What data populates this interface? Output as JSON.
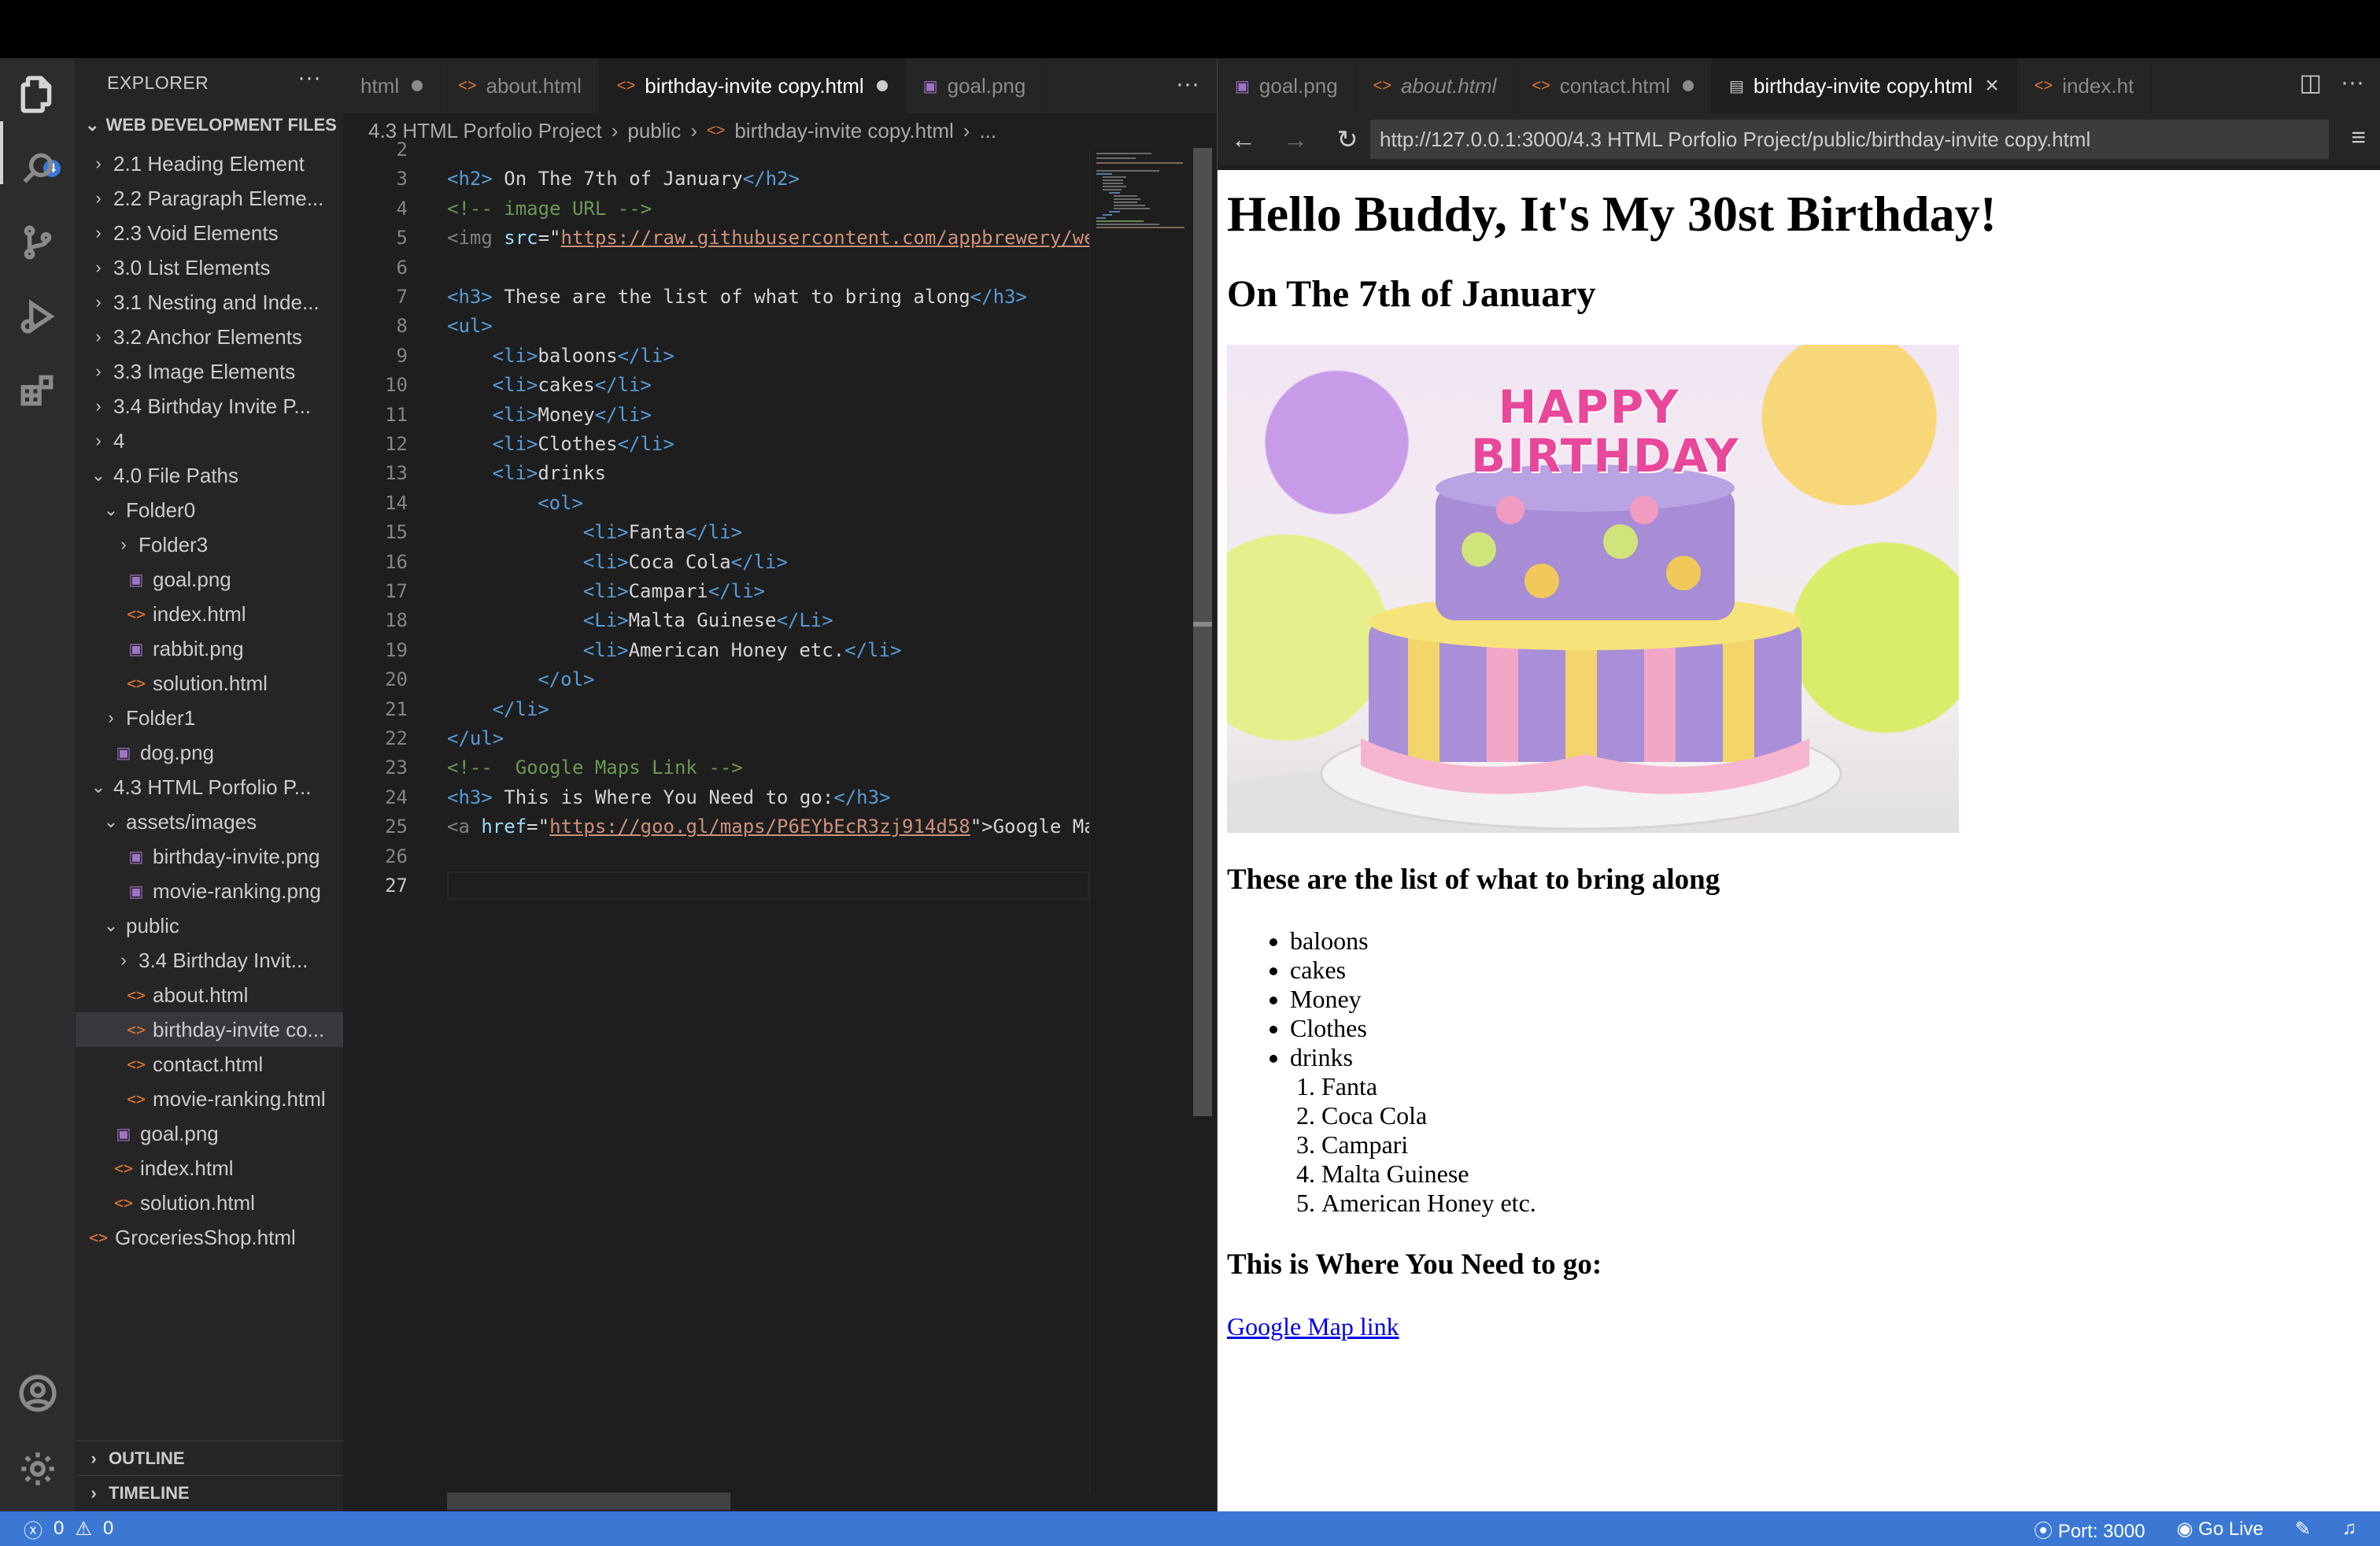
{
  "explorer": {
    "title": "EXPLORER",
    "more": "···",
    "section": "WEB DEVELOPMENT FILES",
    "badge": "4",
    "items": [
      {
        "label": "2.1 Heading Element",
        "type": "folder"
      },
      {
        "label": "2.2 Paragraph Eleme...",
        "type": "folder"
      },
      {
        "label": "2.3 Void Elements",
        "type": "folder"
      },
      {
        "label": "3.0 List Elements",
        "type": "folder"
      },
      {
        "label": "3.1 Nesting and Inde...",
        "type": "folder"
      },
      {
        "label": "3.2 Anchor Elements",
        "type": "folder"
      },
      {
        "label": "3.3 Image Elements",
        "type": "folder"
      },
      {
        "label": "3.4 Birthday Invite P...",
        "type": "folder"
      },
      {
        "label": "4",
        "type": "folder"
      },
      {
        "label": "4.0 File Paths",
        "type": "folder-open"
      },
      {
        "label": "Folder0",
        "type": "folder-open"
      },
      {
        "label": "Folder3",
        "type": "folder"
      },
      {
        "label": "goal.png",
        "type": "image"
      },
      {
        "label": "index.html",
        "type": "html"
      },
      {
        "label": "rabbit.png",
        "type": "image"
      },
      {
        "label": "solution.html",
        "type": "html"
      },
      {
        "label": "Folder1",
        "type": "folder"
      },
      {
        "label": "dog.png",
        "type": "image"
      },
      {
        "label": "4.3 HTML Porfolio P...",
        "type": "folder-open"
      },
      {
        "label": "assets/images",
        "type": "folder-open"
      },
      {
        "label": "birthday-invite.png",
        "type": "image"
      },
      {
        "label": "movie-ranking.png",
        "type": "image"
      },
      {
        "label": "public",
        "type": "folder-open"
      },
      {
        "label": "3.4 Birthday Invit...",
        "type": "folder"
      },
      {
        "label": "about.html",
        "type": "html"
      },
      {
        "label": "birthday-invite co...",
        "type": "html"
      },
      {
        "label": "contact.html",
        "type": "html"
      },
      {
        "label": "movie-ranking.html",
        "type": "html"
      },
      {
        "label": "goal.png",
        "type": "image"
      },
      {
        "label": "index.html",
        "type": "html"
      },
      {
        "label": "solution.html",
        "type": "html"
      },
      {
        "label": "GroceriesShop.html",
        "type": "html"
      }
    ],
    "outline": "OUTLINE",
    "timeline": "TIMELINE"
  },
  "editor": {
    "tabs": [
      {
        "label": "html"
      },
      {
        "label": "about.html"
      },
      {
        "label": "birthday-invite copy.html"
      },
      {
        "label": "goal.png"
      }
    ],
    "more": "···",
    "breadcrumb": [
      "4.3 HTML Porfolio Project",
      "public",
      "birthday-invite copy.html",
      "..."
    ],
    "line_numbers": [
      "2",
      "3",
      "4",
      "5",
      "6",
      "7",
      "8",
      "9",
      "10",
      "11",
      "12",
      "13",
      "14",
      "15",
      "16",
      "17",
      "18",
      "19",
      "20",
      "21",
      "22",
      "23",
      "24",
      "25",
      "26",
      "27"
    ],
    "lines": {
      "l3": {
        "open": "<h2>",
        "text": " On The 7th of January",
        "close": "</h2>"
      },
      "l4": "<!-- image URL -->",
      "l5": {
        "tag": "<img ",
        "attr": "src",
        "eq": "=\"",
        "url": "https://raw.githubusercontent.com/appbrewery/we"
      },
      "l7": {
        "open": "<h3>",
        "text": " These are the list of what to bring along",
        "close": "</h3>"
      },
      "l8": "<ul>",
      "l9": {
        "open": "<li>",
        "text": "baloons",
        "close": "</li>"
      },
      "l10": {
        "open": "<li>",
        "text": "cakes",
        "close": "</li>"
      },
      "l11": {
        "open": "<li>",
        "text": "Money",
        "close": "</li>"
      },
      "l12": {
        "open": "<li>",
        "text": "Clothes",
        "close": "</li>"
      },
      "l13": {
        "open": "<li>",
        "text": "drinks"
      },
      "l14": "<ol>",
      "l15": {
        "open": "<li>",
        "text": "Fanta",
        "close": "</li>"
      },
      "l16": {
        "open": "<li>",
        "text": "Coca Cola",
        "close": "</li>"
      },
      "l17": {
        "open": "<li>",
        "text": "Campari",
        "close": "</li>"
      },
      "l18": {
        "open": "<Li>",
        "text": "Malta Guinese",
        "close": "</Li>"
      },
      "l19": {
        "open": "<li>",
        "text": "American Honey etc.",
        "close": "</li>"
      },
      "l20": "</ol>",
      "l21": "</li>",
      "l22": "</ul>",
      "l23": "<!--  Google Maps Link -->",
      "l24": {
        "open": "<h3>",
        "text": " This is Where You Need to go:",
        "close": "</h3>"
      },
      "l25": {
        "tag": "<a ",
        "attr": "href",
        "eq": "=\"",
        "url": "https://goo.gl/maps/P6EYbEcR3zj914d58",
        "end": "\">Google Ma"
      }
    }
  },
  "preview": {
    "tabs": [
      {
        "label": "goal.png"
      },
      {
        "label": "about.html"
      },
      {
        "label": "contact.html"
      },
      {
        "label": "birthday-invite copy.html"
      },
      {
        "label": "index.ht"
      }
    ],
    "close": "×",
    "url": "http://127.0.0.1:3000/4.3 HTML Porfolio Project/public/birthday-invite copy.html",
    "page": {
      "h1": "Hello Buddy, It's My 30st Birthday!",
      "h2": "On The 7th of January",
      "cake_text": "HAPPY BIRTHDAY",
      "h3_list": "These are the list of what to bring along",
      "items": [
        "baloons",
        "cakes",
        "Money",
        "Clothes",
        "drinks"
      ],
      "drinks": [
        "Fanta",
        "Coca Cola",
        "Campari",
        "Malta Guinese",
        "American Honey etc."
      ],
      "h3_map": "This is Where You Need to go:",
      "link": "Google Map link"
    }
  },
  "status": {
    "errors": "0",
    "warnings": "0",
    "port": "Port: 3000",
    "golive": "Go Live"
  }
}
